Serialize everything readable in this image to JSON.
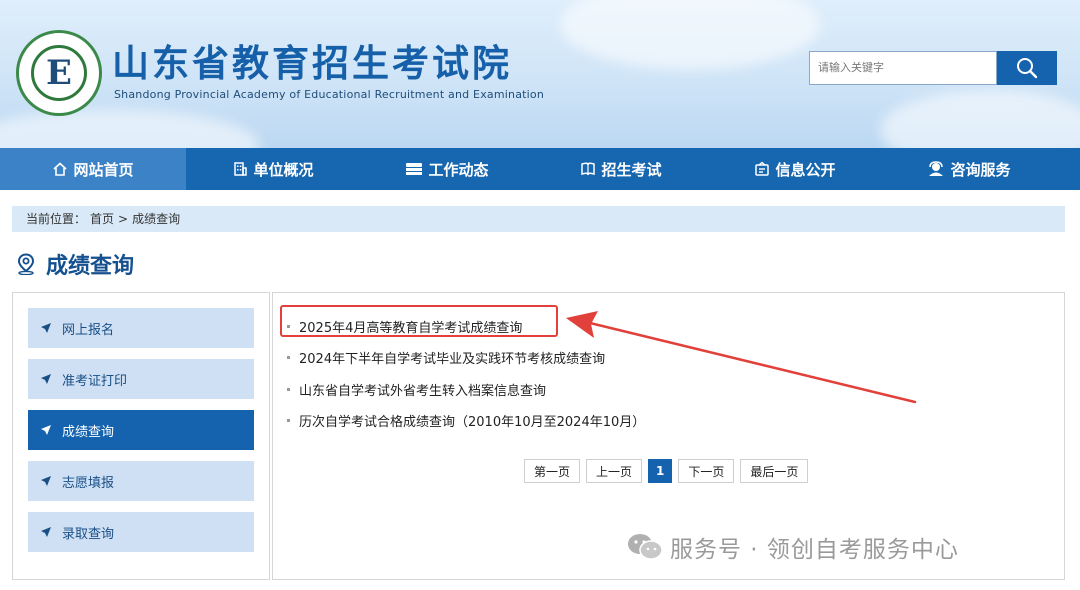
{
  "header": {
    "title": "山东省教育招生考试院",
    "subtitle": "Shandong Provincial Academy of Educational Recruitment and Examination",
    "logo_letter": "E",
    "search_placeholder": "请输入关键字"
  },
  "nav": {
    "items": [
      {
        "label": "网站首页",
        "icon": "home-icon"
      },
      {
        "label": "单位概况",
        "icon": "building-icon"
      },
      {
        "label": "工作动态",
        "icon": "news-icon"
      },
      {
        "label": "招生考试",
        "icon": "exam-icon"
      },
      {
        "label": "信息公开",
        "icon": "info-icon"
      },
      {
        "label": "咨询服务",
        "icon": "service-icon"
      }
    ],
    "active_index": 0
  },
  "breadcrumb": {
    "prefix": "当前位置：",
    "home": "首页",
    "separator": ">",
    "current": "成绩查询"
  },
  "page_title": "成绩查询",
  "sidebar": {
    "items": [
      {
        "label": "网上报名"
      },
      {
        "label": "准考证打印"
      },
      {
        "label": "成绩查询"
      },
      {
        "label": "志愿填报"
      },
      {
        "label": "录取查询"
      }
    ],
    "active_index": 2
  },
  "content": {
    "items": [
      {
        "label": "2025年4月高等教育自学考试成绩查询",
        "highlighted": true
      },
      {
        "label": "2024年下半年自学考试毕业及实践环节考核成绩查询"
      },
      {
        "label": "山东省自学考试外省考生转入档案信息查询"
      },
      {
        "label": "历次自学考试合格成绩查询（2010年10月至2024年10月）"
      }
    ]
  },
  "pagination": {
    "first": "第一页",
    "prev": "上一页",
    "current": "1",
    "next": "下一页",
    "last": "最后一页"
  },
  "watermark": "服务号 · 领创自考服务中心",
  "colors": {
    "primary": "#1563ae",
    "nav_bg": "#1666b0",
    "nav_active": "#3b82c6",
    "sidebar_item": "#cfe0f4",
    "highlight": "#e2403a"
  }
}
